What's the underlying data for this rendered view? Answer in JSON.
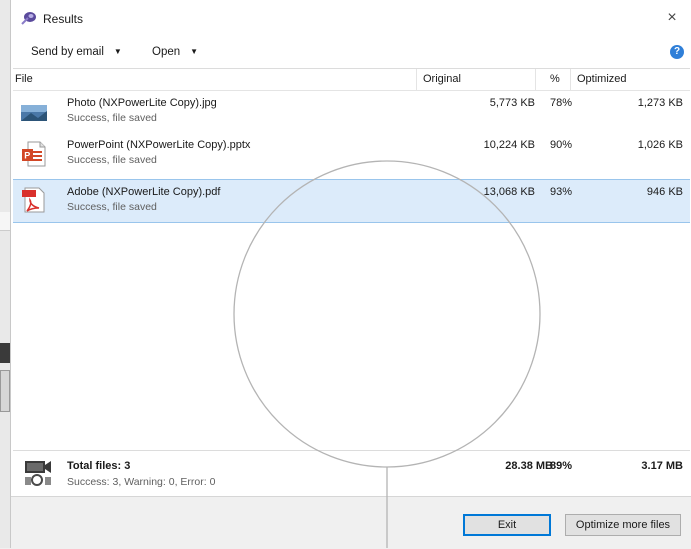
{
  "window": {
    "title": "Results"
  },
  "toolbar": {
    "send_label": "Send by email",
    "open_label": "Open",
    "caret": "▼"
  },
  "columns": {
    "file": "File",
    "original": "Original",
    "percent": "%",
    "optimized": "Optimized"
  },
  "files": [
    {
      "name": "Photo (NXPowerLite Copy).jpg",
      "status": "Success, file saved",
      "original": "5,773 KB",
      "percent": "78%",
      "optimized": "1,273 KB",
      "icon": "jpg-file-icon"
    },
    {
      "name": "PowerPoint (NXPowerLite Copy).pptx",
      "status": "Success, file saved",
      "original": "10,224 KB",
      "percent": "90%",
      "optimized": "1,026 KB",
      "icon": "pptx-file-icon"
    },
    {
      "name": "Adobe (NXPowerLite Copy).pdf",
      "status": "Success, file saved",
      "original": "13,068 KB",
      "percent": "93%",
      "optimized": "946 KB",
      "icon": "pdf-file-icon",
      "selected": true
    }
  ],
  "totals": {
    "label": "Total files: 3",
    "detail": "Success: 3, Warning: 0, Error: 0",
    "original": "28.38 MB",
    "percent": "89%",
    "optimized": "3.17 MB"
  },
  "buttons": {
    "exit": "Exit",
    "optimize_more": "Optimize more files"
  },
  "colors": {
    "selection": "#dcebfa",
    "selection_border": "#99c5ec",
    "help_blue": "#2f7fd8",
    "pdf_red": "#d9302c",
    "ppt_orange": "#d24726"
  },
  "icons": {
    "close": "×",
    "help": "?"
  }
}
